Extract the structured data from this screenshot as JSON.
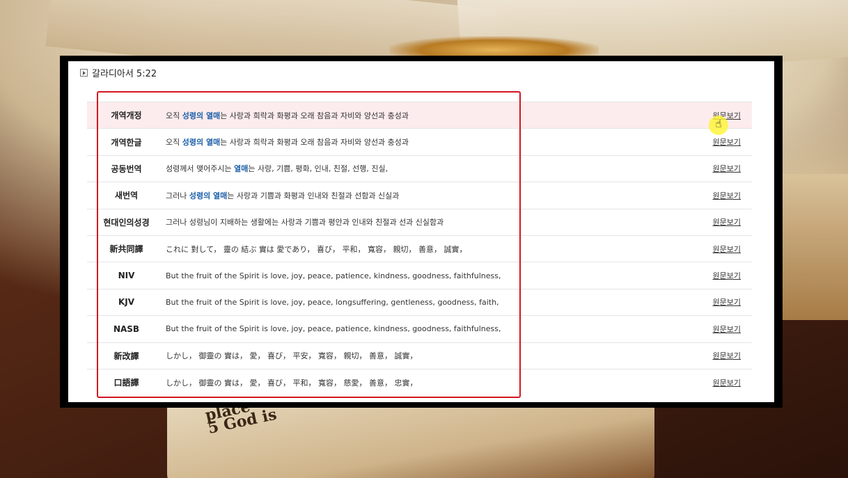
{
  "background": {
    "book_text_line1": "place",
    "book_text_line2": "5 God is"
  },
  "heading": {
    "title": "갈라디아서 5:22"
  },
  "rows": [
    {
      "version": "개역개정",
      "before": "오직 ",
      "keyword": "성령의 열매",
      "after": "는 사랑과 희락과 화평과 오래 참음과 자비와 양선과 충성과",
      "link": "원문보기"
    },
    {
      "version": "개역한글",
      "before": "오직 ",
      "keyword": "성령의 열매",
      "after": "는 사랑과 희락과 화평과 오래 참음과 자비와 양선과 충성과",
      "link": "원문보기"
    },
    {
      "version": "공동번역",
      "before": "성령께서 맺어주시는 ",
      "keyword": "열매",
      "after": "는 사랑, 기쁨, 평화, 인내, 친절, 선행, 진실,",
      "link": "원문보기"
    },
    {
      "version": "새번역",
      "before": "그러나 ",
      "keyword": "성령의 열매",
      "after": "는 사랑과 기쁨과 화평과 인내와 친절과 선함과 신실과",
      "link": "원문보기"
    },
    {
      "version": "현대인의성경",
      "before": "그러나 성령님이 지배하는 생활에는 사랑과 기쁨과 평안과 인내와 친절과 선과 신실함과",
      "keyword": "",
      "after": "",
      "link": "원문보기"
    },
    {
      "version": "新共同譯",
      "before": "これに 對して， 靈の 結ぶ 實は 愛であり， 喜び， 平和， 寬容， 親切， 善意， 誠實，",
      "keyword": "",
      "after": "",
      "link": "원문보기"
    },
    {
      "version": "NIV",
      "before": "But the fruit of the Spirit is love, joy, peace, patience, kindness, goodness, faithfulness,",
      "keyword": "",
      "after": "",
      "link": "원문보기"
    },
    {
      "version": "KJV",
      "before": "But the fruit of the Spirit is love, joy, peace, longsuffering, gentleness, goodness, faith,",
      "keyword": "",
      "after": "",
      "link": "원문보기"
    },
    {
      "version": "NASB",
      "before": "But the fruit of the Spirit is love, joy, peace, patience, kindness, goodness, faithfulness,",
      "keyword": "",
      "after": "",
      "link": "원문보기"
    },
    {
      "version": "新改譯",
      "before": "しかし， 御靈の 實は， 愛， 喜び， 平安， 寬容， 親切， 善意， 誠實，",
      "keyword": "",
      "after": "",
      "link": "원문보기"
    },
    {
      "version": "口語譯",
      "before": "しかし， 御靈の 實は， 愛， 喜び， 平和， 寬容， 慈愛， 善意， 忠實，",
      "keyword": "",
      "after": "",
      "link": "원문보기"
    }
  ],
  "colors": {
    "keyword": "#1d5fa8",
    "highlight_row": "#fdeced",
    "annotation_box": "#d3161f",
    "cursor_halo": "#fff53c"
  },
  "highlighted_row_index": 0
}
